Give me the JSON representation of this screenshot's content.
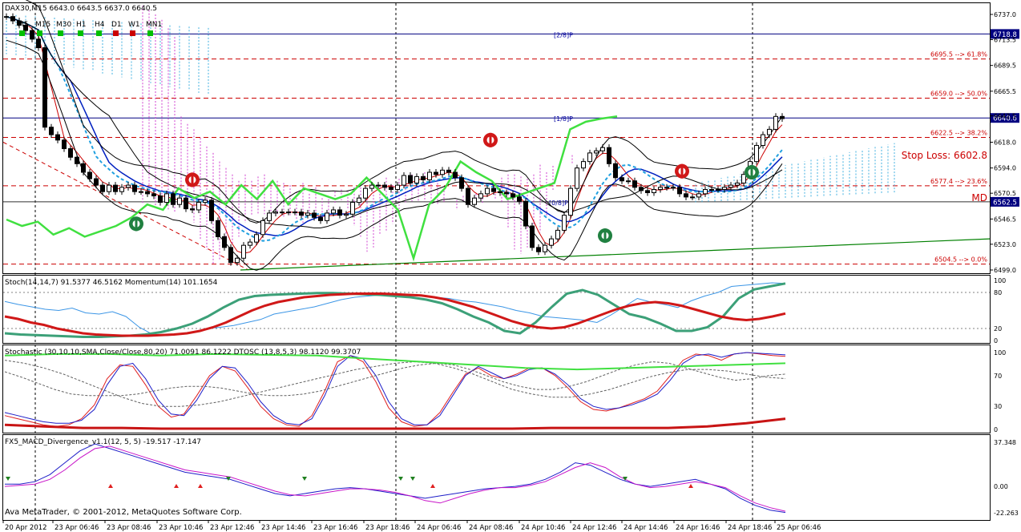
{
  "header": {
    "symbol_line": "DAX30,M15  6643.0 6643.5 6637.0 6640.5",
    "timeframes": [
      {
        "label": "M5",
        "color": "#00c000"
      },
      {
        "label": "M15",
        "color": "#00c000"
      },
      {
        "label": "M30",
        "color": "#00c000"
      },
      {
        "label": "H1",
        "color": "#00c000"
      },
      {
        "label": "H4",
        "color": "#00c000"
      },
      {
        "label": "D1",
        "color": "#cc0000"
      },
      {
        "label": "W1",
        "color": "#cc0000"
      },
      {
        "label": "MN1",
        "color": "#00c000"
      }
    ]
  },
  "panels": {
    "main": {
      "y_ticks": [
        "6737.0",
        "6713.5",
        "6689.5",
        "6665.5",
        "6642.5",
        "6618.0",
        "6594.0",
        "6570.5",
        "6546.5",
        "6523.0",
        "6499.0"
      ],
      "price_tags": [
        {
          "label": "6718.8",
          "value": 6718.8,
          "color": "#000080"
        },
        {
          "label": "6640.6",
          "value": 6640.6,
          "color": "#000080"
        },
        {
          "label": "6562.5",
          "value": 6562.5,
          "color": "#000080"
        }
      ],
      "murrey": [
        {
          "label": "[2/8]P",
          "value": 6718.8,
          "color": "#0000a0"
        },
        {
          "label": "[1/8]P",
          "value": 6640.6,
          "color": "#0000a0"
        },
        {
          "label": "[0/8]P",
          "value": 6562.5,
          "color": "#0000a0"
        }
      ],
      "fib_levels": [
        {
          "label": "6695.5 --> 61.8%",
          "value": 6695.5
        },
        {
          "label": "6659.0 --> 50.0%",
          "value": 6659.0
        },
        {
          "label": "6622.5 --> 38.2%",
          "value": 6622.5
        },
        {
          "label": "6577.4 --> 23.6%",
          "value": 6577.4
        },
        {
          "label": "6504.5 --> 0.0%",
          "value": 6504.5
        }
      ],
      "stop_loss": {
        "label": "Stop Loss: 6602.8",
        "value": 6602.8
      },
      "md_label": "MD",
      "md_value": 6562.5,
      "close_series": [
        6735,
        6731,
        6727,
        6722,
        6714,
        6706,
        6632,
        6625,
        6620,
        6612,
        6604,
        6598,
        6590,
        6584,
        6578,
        6572,
        6578,
        6572,
        6576,
        6578,
        6572,
        6572,
        6570,
        6568,
        6562,
        6570,
        6560,
        6566,
        6556,
        6555,
        6562,
        6564,
        6545,
        6530,
        6520,
        6506,
        6510,
        6522,
        6525,
        6532,
        6545,
        6552,
        6553,
        6553,
        6553,
        6553,
        6550,
        6552,
        6548,
        6545,
        6552,
        6555,
        6550,
        6551,
        6562,
        6566,
        6575,
        6578,
        6578,
        6576,
        6574,
        6578,
        6587,
        6580,
        6586,
        6583,
        6590,
        6588,
        6592,
        6590,
        6585,
        6575,
        6560,
        6566,
        6570,
        6575,
        6572,
        6571,
        6570,
        6567,
        6563,
        6540,
        6520,
        6516,
        6522,
        6528,
        6536,
        6550,
        6575,
        6594,
        6600,
        6608,
        6610,
        6613,
        6598,
        6585,
        6582,
        6582,
        6576,
        6573,
        6571,
        6574,
        6576,
        6576,
        6576,
        6570,
        6567,
        6567,
        6570,
        6574,
        6574,
        6574,
        6576,
        6578,
        6580,
        6588,
        6600,
        6615,
        6625,
        6630,
        6642,
        6640
      ]
    },
    "stoch": {
      "label": "Stoch(14,14,7) 91.5377 46.5162  Momentum(14) 101.1654",
      "y_ticks": [
        "100",
        "80",
        "20",
        "0"
      ],
      "levels": [
        80,
        20
      ],
      "series": [
        {
          "name": "Momentum(14)",
          "color": "#3c96e6",
          "width": 1,
          "values": [
            65,
            60,
            56,
            52,
            50,
            54,
            46,
            44,
            48,
            40,
            22,
            10,
            8,
            10,
            14,
            20,
            22,
            25,
            30,
            35,
            44,
            48,
            52,
            56,
            62,
            68,
            72,
            74,
            76,
            78,
            76,
            74,
            72,
            70,
            66,
            64,
            60,
            56,
            50,
            46,
            40,
            38,
            36,
            34,
            30,
            42,
            56,
            70,
            64,
            60,
            55,
            66,
            74,
            80,
            90,
            92,
            94,
            96,
            95
          ]
        },
        {
          "name": "Stoch %K",
          "color": "#3ca078",
          "width": 3,
          "values": [
            12,
            10,
            9,
            8,
            7,
            6,
            6,
            7,
            8,
            10,
            14,
            20,
            28,
            40,
            55,
            68,
            74,
            76,
            77,
            78,
            79,
            79,
            78,
            77,
            76,
            74,
            72,
            68,
            62,
            52,
            40,
            30,
            16,
            12,
            30,
            55,
            78,
            84,
            76,
            60,
            44,
            38,
            28,
            16,
            16,
            22,
            40,
            70,
            85,
            90,
            95
          ]
        },
        {
          "name": "Stoch %D",
          "color": "#d01818",
          "width": 3,
          "values": [
            40,
            36,
            30,
            26,
            20,
            16,
            12,
            10,
            9,
            8,
            8,
            8,
            9,
            10,
            12,
            16,
            22,
            30,
            40,
            50,
            58,
            64,
            68,
            72,
            74,
            76,
            77,
            78,
            78,
            78,
            77,
            76,
            75,
            72,
            68,
            62,
            56,
            48,
            40,
            32,
            26,
            22,
            20,
            22,
            28,
            36,
            44,
            52,
            58,
            62,
            64,
            62,
            58,
            52,
            46,
            40,
            36,
            34,
            36,
            40,
            45
          ]
        }
      ]
    },
    "stochastic2": {
      "label": "Stochastic (30,10,10,SMA,Close/Close,80,20) 71.0091 86.1222  DTOSC (13,8,5,3) 98.1120 99.3707",
      "y_ticks": [
        "100",
        "70",
        "30",
        "0"
      ],
      "series": [
        {
          "name": "DTOSC red",
          "color": "#e02020",
          "width": 1,
          "values": [
            18,
            14,
            10,
            6,
            4,
            6,
            14,
            32,
            66,
            84,
            82,
            58,
            30,
            16,
            20,
            44,
            70,
            82,
            76,
            54,
            30,
            14,
            6,
            4,
            18,
            50,
            88,
            96,
            88,
            62,
            28,
            10,
            4,
            6,
            22,
            48,
            72,
            80,
            70,
            66,
            72,
            80,
            80,
            70,
            54,
            36,
            26,
            24,
            28,
            34,
            40,
            50,
            70,
            90,
            98,
            96,
            90,
            98,
            100,
            98,
            96,
            95
          ]
        },
        {
          "name": "DTOSC blue",
          "color": "#1e1ec8",
          "width": 1,
          "values": [
            22,
            18,
            14,
            10,
            8,
            8,
            12,
            26,
            58,
            82,
            86,
            66,
            38,
            20,
            18,
            38,
            66,
            82,
            80,
            60,
            36,
            18,
            8,
            6,
            14,
            44,
            82,
            96,
            92,
            70,
            36,
            14,
            6,
            6,
            18,
            44,
            70,
            82,
            74,
            66,
            70,
            78,
            80,
            72,
            58,
            40,
            30,
            26,
            28,
            32,
            38,
            46,
            64,
            86,
            96,
            98,
            94,
            98,
            100,
            99,
            98,
            97
          ]
        },
        {
          "name": "Stochastic main",
          "color": "#606060",
          "width": 1,
          "values": [
            75,
            68,
            60,
            52,
            46,
            44,
            44,
            44,
            46,
            50,
            54,
            56,
            56,
            54,
            50,
            46,
            44,
            44,
            46,
            50,
            56,
            62,
            68,
            74,
            80,
            84,
            86,
            84,
            78,
            70,
            62,
            56,
            52,
            52,
            56,
            62,
            70,
            78,
            84,
            88,
            86,
            80,
            74,
            68,
            64,
            66,
            70,
            72
          ]
        },
        {
          "name": "Stochastic signal",
          "color": "#606060",
          "width": 1,
          "values": [
            90,
            86,
            80,
            72,
            62,
            52,
            42,
            34,
            30,
            30,
            32,
            36,
            42,
            48,
            54,
            60,
            66,
            72,
            78,
            82,
            86,
            88,
            86,
            80,
            72,
            62,
            52,
            46,
            42,
            42,
            46,
            52,
            60,
            68,
            74,
            78,
            78,
            76,
            72,
            68,
            66
          ]
        },
        {
          "name": "Signal red",
          "color": "#c81414",
          "width": 3,
          "values": [
            6,
            4,
            2,
            2,
            1,
            1,
            1,
            1,
            1,
            1,
            1,
            1,
            1,
            1,
            2,
            2,
            2,
            2,
            4,
            8,
            14
          ]
        },
        {
          "name": "Signal green",
          "color": "#40e040",
          "width": 2,
          "values": [
            96,
            98,
            98,
            96,
            98,
            97,
            96,
            92,
            88,
            84,
            80,
            78,
            80,
            82,
            84,
            86
          ]
        }
      ]
    },
    "macd": {
      "label": "FX5_MACD_Divergence_v1.1(12, 5, 5) -19.517 -17.147",
      "y_ticks": [
        "37.348",
        "0.00",
        "-22.263"
      ],
      "series": [
        {
          "name": "MACD",
          "color": "#1e1ec8",
          "width": 1,
          "values": [
            2,
            2,
            4,
            10,
            20,
            30,
            36,
            32,
            28,
            24,
            20,
            16,
            12,
            10,
            8,
            6,
            2,
            -2,
            -6,
            -8,
            -6,
            -4,
            -2,
            -1,
            -2,
            -4,
            -6,
            -8,
            -10,
            -8,
            -6,
            -4,
            -2,
            -1,
            0,
            2,
            6,
            12,
            20,
            18,
            12,
            6,
            2,
            0,
            2,
            4,
            6,
            2,
            -2,
            -10,
            -16,
            -20,
            -22
          ]
        },
        {
          "name": "Signal",
          "color": "#c814c8",
          "width": 1,
          "values": [
            0,
            1,
            2,
            6,
            14,
            24,
            32,
            34,
            30,
            26,
            22,
            18,
            14,
            12,
            10,
            8,
            4,
            0,
            -4,
            -7,
            -8,
            -6,
            -4,
            -2,
            -2,
            -3,
            -5,
            -8,
            -12,
            -14,
            -10,
            -6,
            -3,
            -1,
            -1,
            1,
            4,
            10,
            16,
            20,
            16,
            8,
            2,
            -1,
            0,
            2,
            4,
            2,
            -1,
            -8,
            -14,
            -18,
            -21
          ]
        }
      ]
    }
  },
  "x_axis": {
    "ticks": [
      "20 Apr 2012",
      "23 Apr 06:46",
      "23 Apr 08:46",
      "23 Apr 10:46",
      "23 Apr 12:46",
      "23 Apr 14:46",
      "23 Apr 16:46",
      "23 Apr 18:46",
      "24 Apr 06:46",
      "24 Apr 08:46",
      "24 Apr 10:46",
      "24 Apr 12:46",
      "24 Apr 14:46",
      "24 Apr 16:46",
      "24 Apr 18:46",
      "25 Apr 06:46"
    ]
  },
  "copyright": "Ava MetaTrader, © 2001-2012, MetaQuotes Software Corp.",
  "colors": {
    "grid": "#000000",
    "fib_line": "#cc0000",
    "price_line": "#000080",
    "rsi_green": "#40e040",
    "ichimoku_magenta": "#d040d0",
    "ichimoku_cyan": "#40b0e0"
  },
  "chart_data": {
    "type": "line",
    "title": "DAX30,M15  6643.0 6643.5 6637.0 6640.5",
    "x": [
      "20 Apr 2012",
      "23 Apr 06:46",
      "23 Apr 08:46",
      "23 Apr 10:46",
      "23 Apr 12:46",
      "23 Apr 14:46",
      "23 Apr 16:46",
      "23 Apr 18:46",
      "24 Apr 06:46",
      "24 Apr 08:46",
      "24 Apr 10:46",
      "24 Apr 12:46",
      "24 Apr 14:46",
      "24 Apr 16:46",
      "24 Apr 18:46",
      "25 Apr 06:46"
    ],
    "series": [
      {
        "name": "DAX30",
        "values": [
          6737,
          6632,
          6578,
          6572,
          6555,
          6522,
          6553,
          6552,
          6578,
          6590,
          6570,
          6516,
          6608,
          6570,
          6576,
          6640
        ]
      }
    ],
    "ylim": [
      6499,
      6737
    ]
  }
}
